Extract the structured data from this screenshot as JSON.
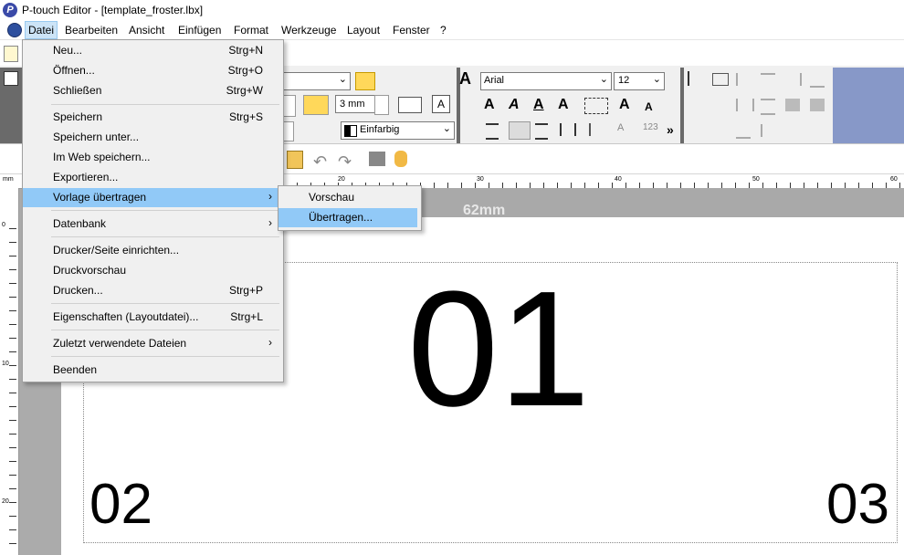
{
  "window": {
    "title": "P-touch Editor - [template_froster.lbx]"
  },
  "menubar": [
    {
      "label": "Datei"
    },
    {
      "label": "Bearbeiten"
    },
    {
      "label": "Ansicht"
    },
    {
      "label": "Einfügen"
    },
    {
      "label": "Format"
    },
    {
      "label": "Werkzeuge"
    },
    {
      "label": "Layout"
    },
    {
      "label": "Fenster"
    },
    {
      "label": "?"
    }
  ],
  "file_menu": {
    "items": [
      {
        "label": "Neu...",
        "shortcut": "Strg+N"
      },
      {
        "label": "Öffnen...",
        "shortcut": "Strg+O"
      },
      {
        "label": "Schließen",
        "shortcut": "Strg+W"
      },
      {
        "label": "Speichern",
        "shortcut": "Strg+S"
      },
      {
        "label": "Speichern unter...",
        "shortcut": ""
      },
      {
        "label": "Im Web speichern...",
        "shortcut": ""
      },
      {
        "label": "Exportieren...",
        "shortcut": ""
      },
      {
        "label": "Vorlage übertragen",
        "shortcut": ""
      },
      {
        "label": "Datenbank",
        "shortcut": ""
      },
      {
        "label": "Drucker/Seite einrichten...",
        "shortcut": ""
      },
      {
        "label": "Druckvorschau",
        "shortcut": ""
      },
      {
        "label": "Drucken...",
        "shortcut": "Strg+P"
      },
      {
        "label": "Eigenschaften (Layoutdatei)...",
        "shortcut": "Strg+L"
      },
      {
        "label": "Zuletzt verwendete Dateien",
        "shortcut": ""
      },
      {
        "label": "Beenden",
        "shortcut": ""
      }
    ]
  },
  "submenu": {
    "items": [
      {
        "label": "Vorschau"
      },
      {
        "label": "Übertragen..."
      }
    ]
  },
  "ribbon": {
    "font_name": "Arial",
    "font_size": "12",
    "margin": "3 mm",
    "fill": "Einfarbig"
  },
  "ruler": {
    "unit": "mm",
    "h_labels": [
      "20",
      "30",
      "40",
      "50",
      "60"
    ],
    "v_labels": [
      "0",
      "10",
      "20"
    ]
  },
  "canvas": {
    "tape_width": "62mm",
    "text_main": "01",
    "text_left": "02",
    "text_right": "03"
  },
  "colors": {
    "menu_highlight": "#91c9f7",
    "ribbon_blue": "#8798c8",
    "canvas_bg": "#ababab"
  }
}
